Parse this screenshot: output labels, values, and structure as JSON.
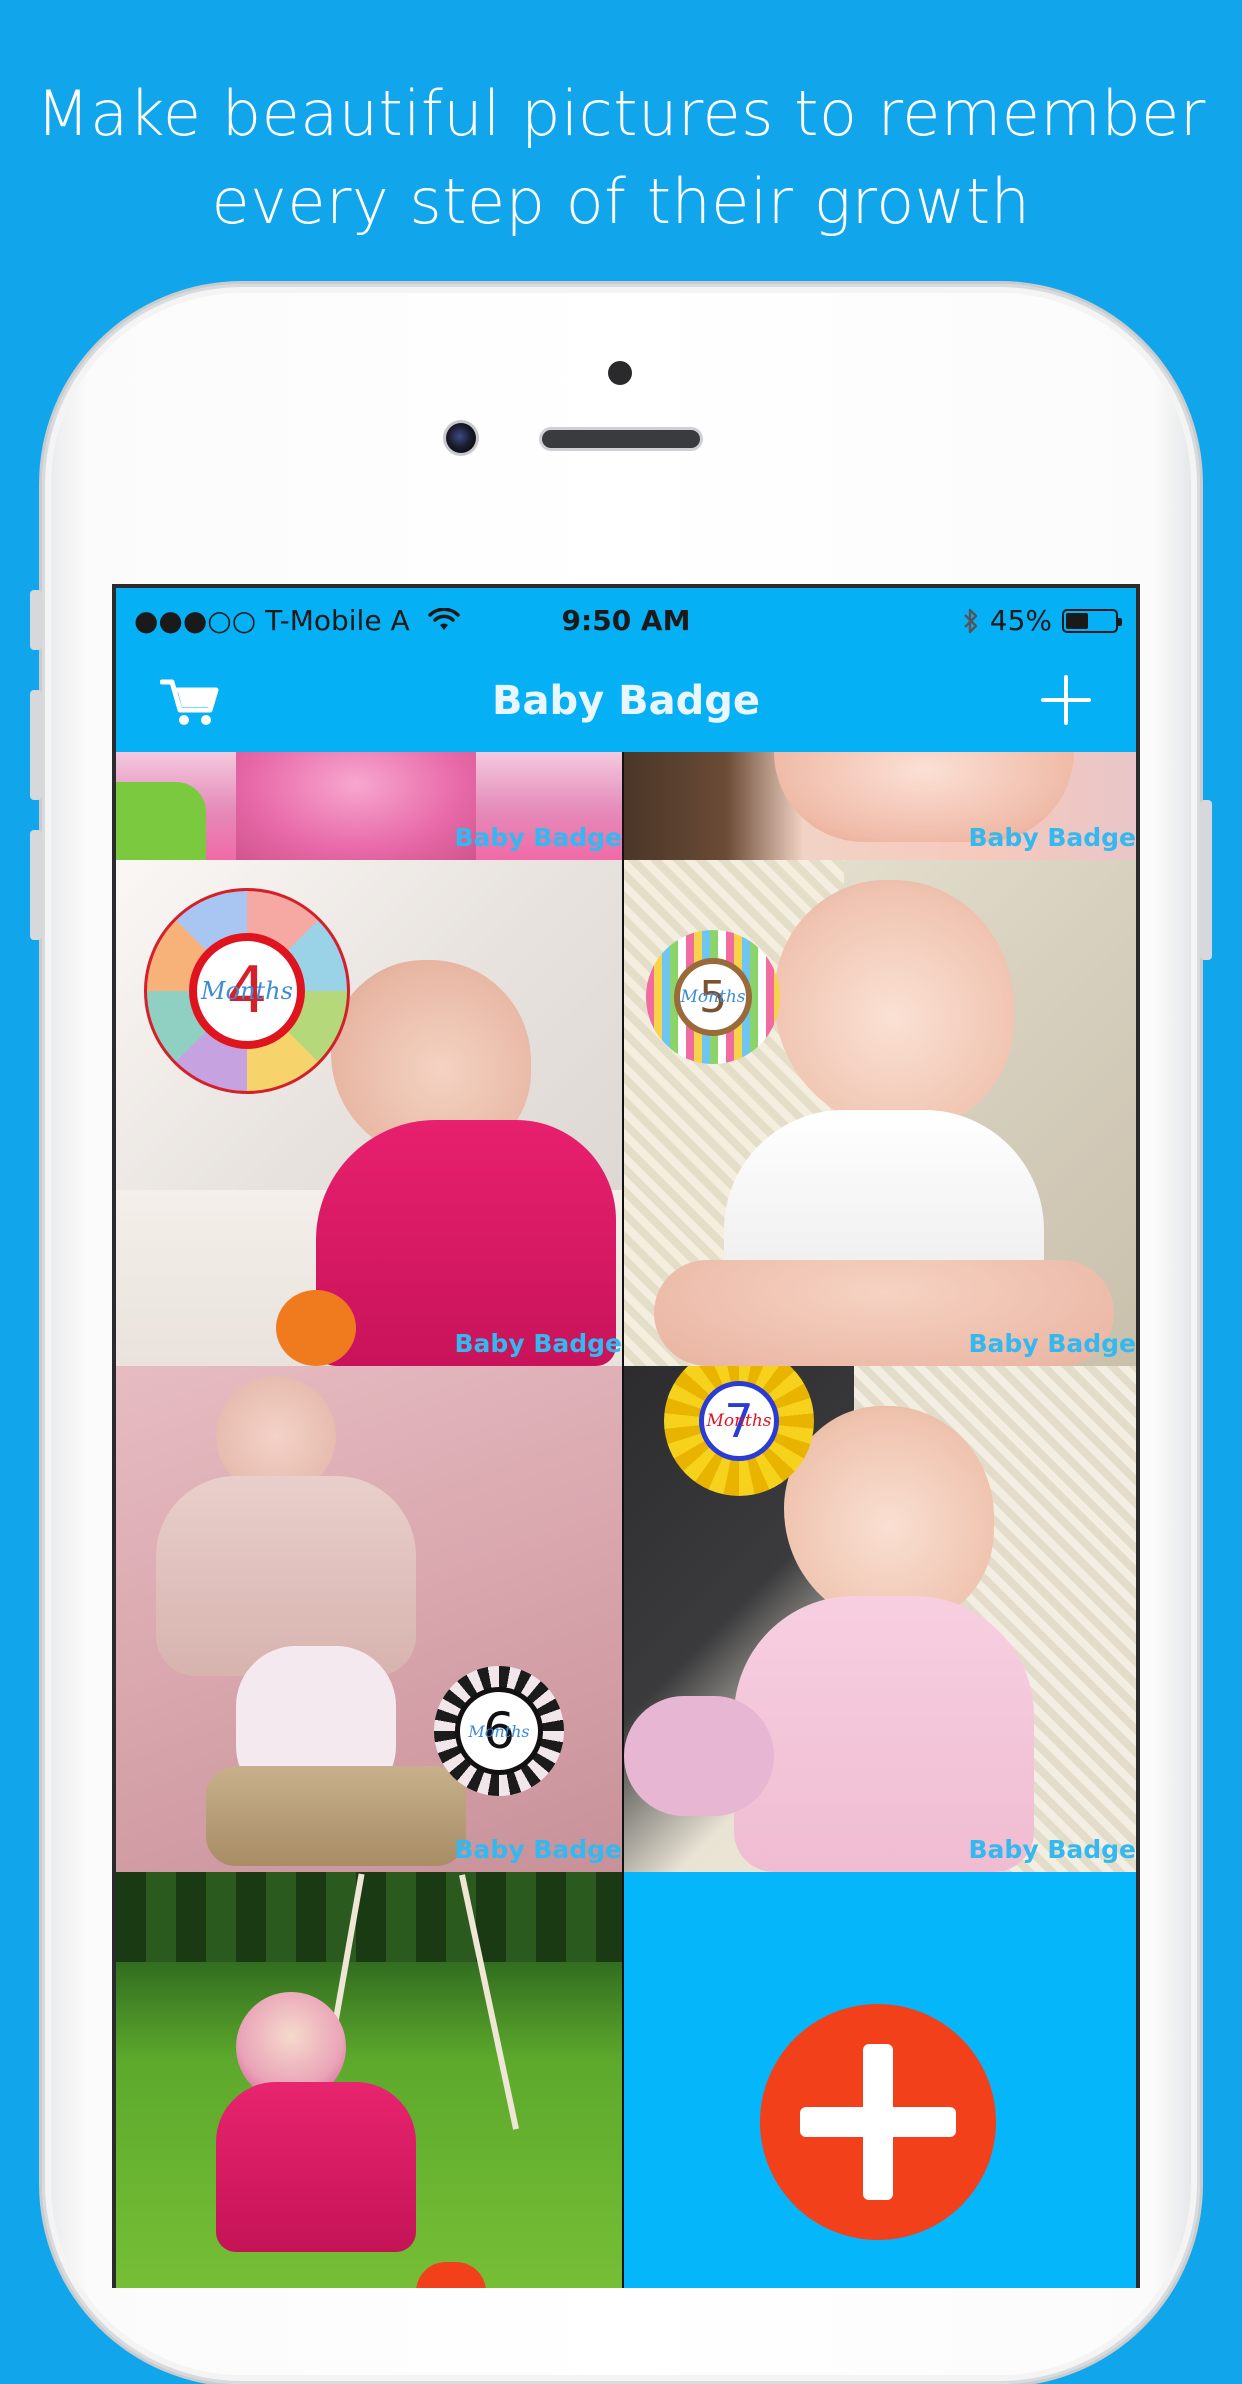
{
  "headline": {
    "line1": "Make beautiful pictures to remember",
    "line2": "every step of their growth"
  },
  "status_bar": {
    "signal": "●●●○○",
    "carrier": "T-Mobile A",
    "time": "9:50 AM",
    "battery_text": "45%",
    "battery_level": 0.45
  },
  "nav": {
    "title": "Baby Badge",
    "left_icon": "cart-icon",
    "right_icon": "plus-icon"
  },
  "watermark": "Baby Badge",
  "photos": [
    {
      "id": "top-left",
      "badge": null
    },
    {
      "id": "top-right",
      "badge": null
    },
    {
      "id": "photo-4",
      "badge": {
        "number": "4",
        "text": "Months"
      }
    },
    {
      "id": "photo-5",
      "badge": {
        "number": "5",
        "text": "Months"
      }
    },
    {
      "id": "photo-6",
      "badge": {
        "number": "6",
        "text": "Months"
      }
    },
    {
      "id": "photo-7",
      "badge": {
        "number": "7",
        "text": "Months"
      }
    },
    {
      "id": "photo-swing",
      "badge": null
    }
  ],
  "colors": {
    "background": "#11a6ec",
    "nav": "#05b0f5",
    "add_button": "#f1401a",
    "watermark": "#33b8ef"
  }
}
